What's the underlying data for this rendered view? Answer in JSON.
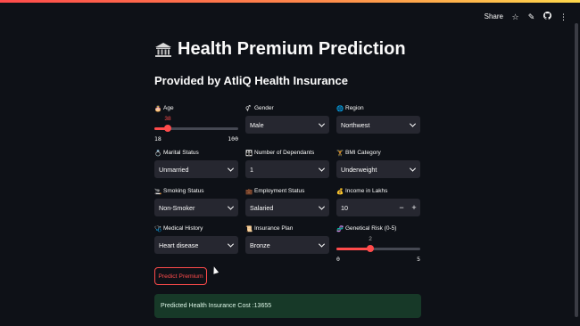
{
  "header": {
    "share_label": "Share",
    "icons": [
      "star-icon",
      "pencil-icon",
      "github-icon",
      "more-vertical-icon"
    ]
  },
  "title": "Health Premium Prediction",
  "subtitle": "Provided by AtliQ Health Insurance",
  "fields": {
    "age": {
      "label": "Age",
      "icon": "🎂",
      "value": "38",
      "min": "18",
      "max": "100"
    },
    "gender": {
      "label": "Gender",
      "icon": "⚥",
      "value": "Male"
    },
    "region": {
      "label": "Region",
      "icon": "🌐",
      "value": "Northwest"
    },
    "marital_status": {
      "label": "Marital Status",
      "icon": "💍",
      "value": "Unmarried"
    },
    "dependants": {
      "label": "Number of Dependants",
      "icon": "👪",
      "value": "1"
    },
    "bmi": {
      "label": "BMI Category",
      "icon": "🏋",
      "value": "Underweight"
    },
    "smoking": {
      "label": "Smoking Status",
      "icon": "🚬",
      "value": "Non-Smoker"
    },
    "employment": {
      "label": "Employment Status",
      "icon": "💼",
      "value": "Salaried"
    },
    "income": {
      "label": "Income in Lakhs",
      "icon": "💰",
      "value": "10",
      "minus": "−",
      "plus": "+"
    },
    "medical_history": {
      "label": "Medical History",
      "icon": "🩺",
      "value": "Heart disease"
    },
    "insurance_plan": {
      "label": "Insurance Plan",
      "icon": "📜",
      "value": "Bronze"
    },
    "genetical_risk": {
      "label": "Genetical Risk (0-5)",
      "icon": "🧬",
      "value": "2",
      "min": "0",
      "max": "5"
    }
  },
  "predict_button": "Predict Premium",
  "result_text": "Predicted Health Insurance Cost :13655",
  "colors": {
    "accent": "#ff4b4b",
    "background": "#0e1117",
    "input_bg": "#262730",
    "success_bg": "#173928"
  }
}
